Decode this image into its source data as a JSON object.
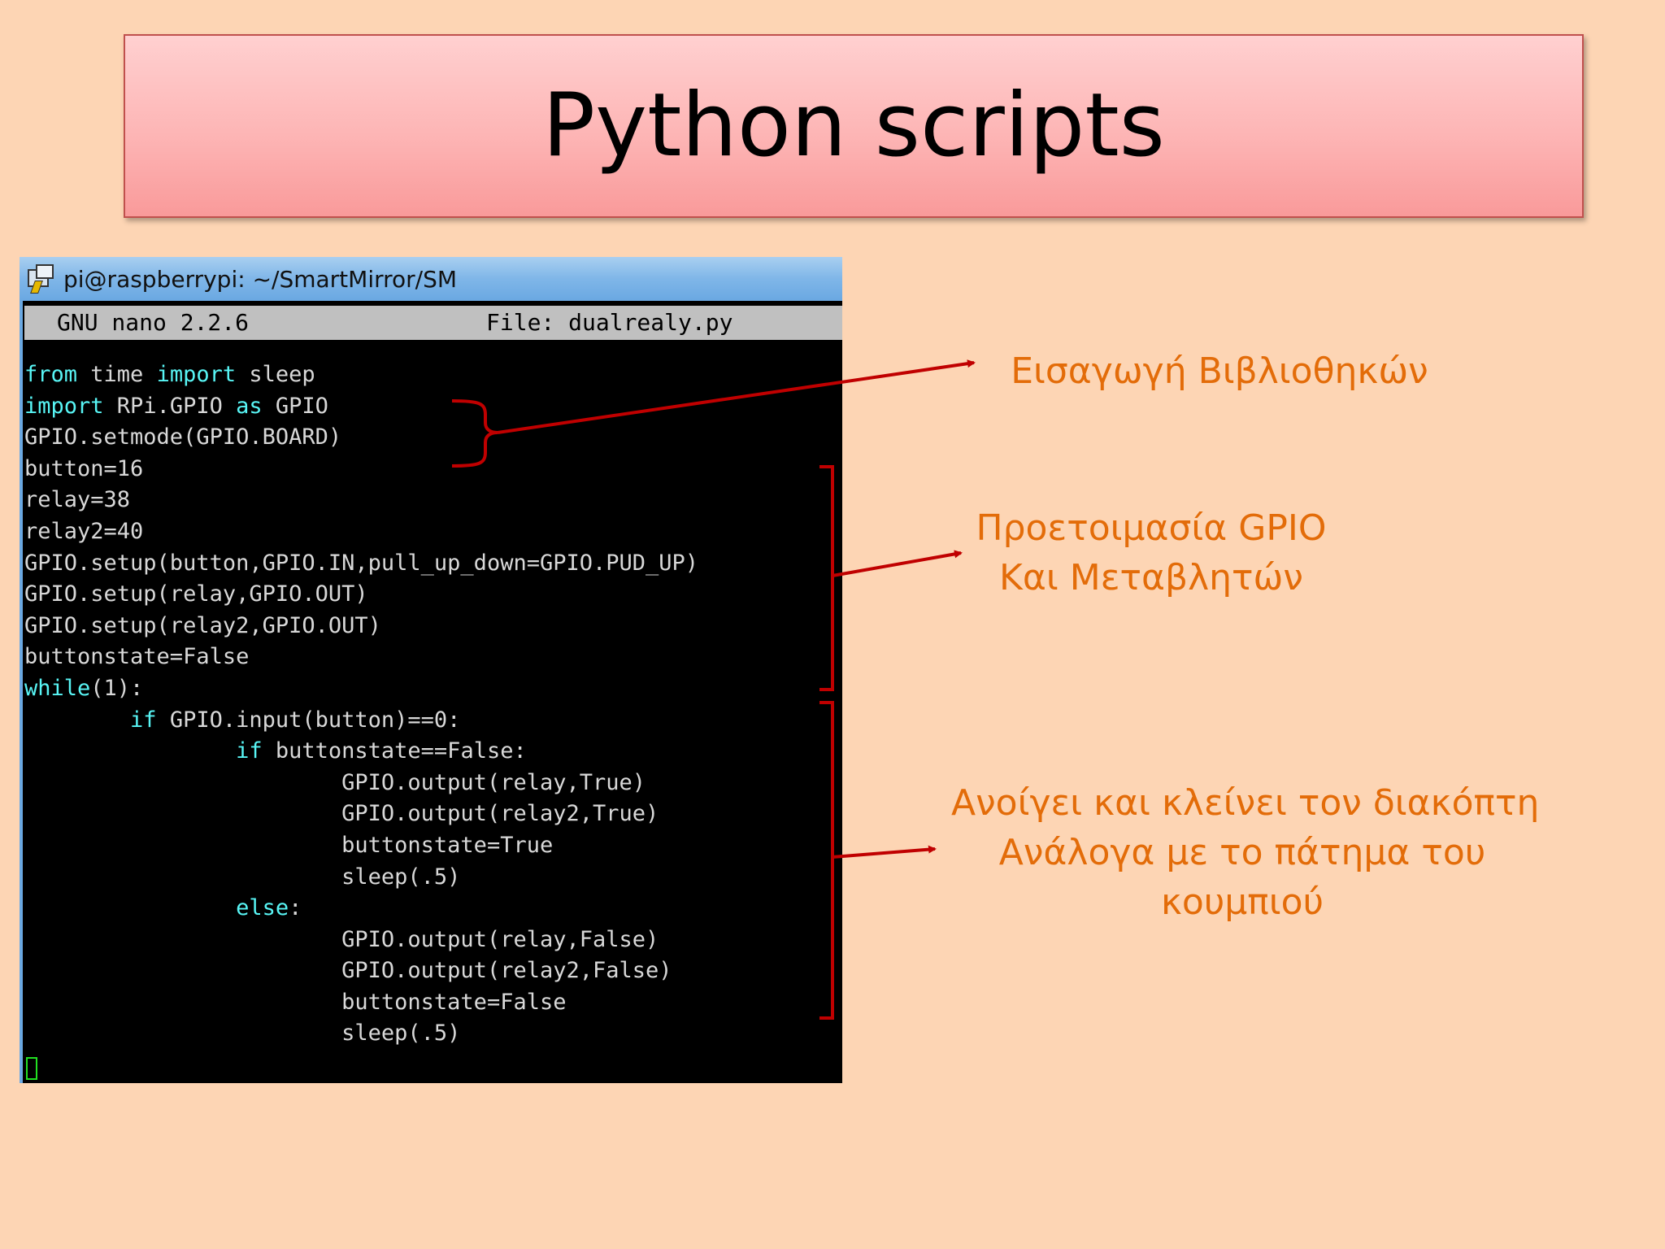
{
  "slide": {
    "title": "Python scripts"
  },
  "terminal": {
    "window_title": "pi@raspberrypi: ~/SmartMirror/SM",
    "icon": "putty-icon",
    "nano_version": "GNU nano 2.2.6",
    "nano_file": "File: dualrealy.py",
    "code_lines": [
      [
        {
          "t": "from",
          "k": true
        },
        {
          "t": " time "
        },
        {
          "t": "import",
          "k": true
        },
        {
          "t": " sleep"
        }
      ],
      [
        {
          "t": "import",
          "k": true
        },
        {
          "t": " RPi.GPIO "
        },
        {
          "t": "as",
          "k": true
        },
        {
          "t": " GPIO"
        }
      ],
      [
        {
          "t": "GPIO.setmode(GPIO.BOARD)"
        }
      ],
      [
        {
          "t": "button=16"
        }
      ],
      [
        {
          "t": "relay=38"
        }
      ],
      [
        {
          "t": "relay2=40"
        }
      ],
      [
        {
          "t": "GPIO.setup(button,GPIO.IN,pull_up_down=GPIO.PUD_UP)"
        }
      ],
      [
        {
          "t": "GPIO.setup(relay,GPIO.OUT)"
        }
      ],
      [
        {
          "t": "GPIO.setup(relay2,GPIO.OUT)"
        }
      ],
      [
        {
          "t": "buttonstate=False"
        }
      ],
      [
        {
          "t": "while",
          "k": true
        },
        {
          "t": "(1):"
        }
      ],
      [
        {
          "t": "        "
        },
        {
          "t": "if",
          "k": true
        },
        {
          "t": " GPIO.input(button)==0:"
        }
      ],
      [
        {
          "t": "                "
        },
        {
          "t": "if",
          "k": true
        },
        {
          "t": " buttonstate==False:"
        }
      ],
      [
        {
          "t": "                        GPIO.output(relay,True)"
        }
      ],
      [
        {
          "t": "                        GPIO.output(relay2,True)"
        }
      ],
      [
        {
          "t": "                        buttonstate=True"
        }
      ],
      [
        {
          "t": "                        sleep(.5)"
        }
      ],
      [
        {
          "t": "                "
        },
        {
          "t": "else",
          "k": true
        },
        {
          "t": ":"
        }
      ],
      [
        {
          "t": "                        GPIO.output(relay,False)"
        }
      ],
      [
        {
          "t": "                        GPIO.output(relay2,False)"
        }
      ],
      [
        {
          "t": "                        buttonstate=False"
        }
      ],
      [
        {
          "t": "                        sleep(.5)"
        }
      ]
    ]
  },
  "annotations": {
    "imports_label": "Εισαγωγή Βιβλιοθηκών",
    "setup_label_line1": "Προετοιμασία GPIO",
    "setup_label_line2": "Και Μεταβλητών",
    "loop_label_line1": "Ανοίγει και κλείνει τον διακόπτη",
    "loop_label_line2": "Ανάλογα με το πάτημα του",
    "loop_label_line3": "κουμπιού"
  },
  "colors": {
    "background": "#fdd5b4",
    "annotation_text": "#e36c09",
    "bracket_arrow": "#c00000",
    "keyword": "#58f5f5",
    "code_text": "#d8d8d8"
  }
}
